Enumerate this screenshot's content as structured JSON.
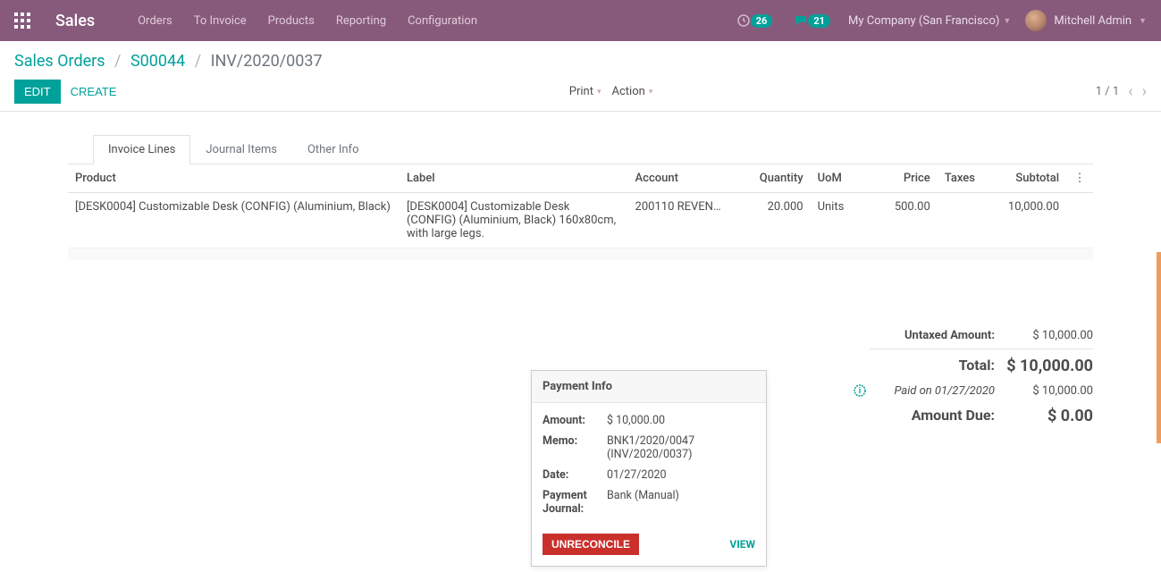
{
  "navbar": {
    "brand": "Sales",
    "links": [
      "Orders",
      "To Invoice",
      "Products",
      "Reporting",
      "Configuration"
    ],
    "badge1": "26",
    "badge2": "21",
    "company": "My Company (San Francisco)",
    "user": "Mitchell Admin"
  },
  "breadcrumb": {
    "root": "Sales Orders",
    "order": "S00044",
    "current": "INV/2020/0037"
  },
  "actions": {
    "edit": "EDIT",
    "create": "CREATE",
    "print": "Print",
    "action": "Action"
  },
  "pager": {
    "text": "1 / 1"
  },
  "tabs": {
    "t1": "Invoice Lines",
    "t2": "Journal Items",
    "t3": "Other Info"
  },
  "table": {
    "headers": {
      "product": "Product",
      "label": "Label",
      "account": "Account",
      "quantity": "Quantity",
      "uom": "UoM",
      "price": "Price",
      "taxes": "Taxes",
      "subtotal": "Subtotal"
    },
    "row": {
      "product": "[DESK0004] Customizable Desk (CONFIG) (Aluminium, Black)",
      "label": "[DESK0004] Customizable Desk (CONFIG) (Aluminium, Black) 160x80cm, with large legs.",
      "account": "200110 REVEN…",
      "quantity": "20.000",
      "uom": "Units",
      "price": "500.00",
      "taxes": "",
      "subtotal": "10,000.00"
    }
  },
  "totals": {
    "untaxed_label": "Untaxed Amount:",
    "untaxed_val": "$ 10,000.00",
    "total_label": "Total:",
    "total_val": "$ 10,000.00",
    "paid_label": "Paid on 01/27/2020",
    "paid_val": "$ 10,000.00",
    "due_label": "Amount Due:",
    "due_val": "$ 0.00"
  },
  "popover": {
    "title": "Payment Info",
    "amount_l": "Amount:",
    "amount_v": "$ 10,000.00",
    "memo_l": "Memo:",
    "memo_v": "BNK1/2020/0047 (INV/2020/0037)",
    "date_l": "Date:",
    "date_v": "01/27/2020",
    "journal_l": "Payment Journal:",
    "journal_v": "Bank (Manual)",
    "unreconcile": "UNRECONCILE",
    "view": "VIEW"
  }
}
